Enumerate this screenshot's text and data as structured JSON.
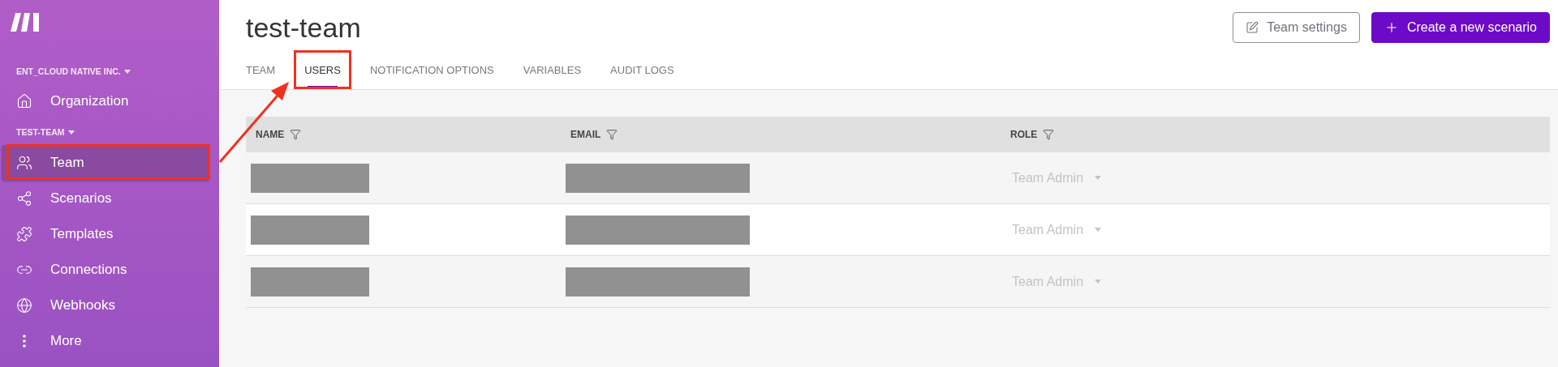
{
  "sidebar": {
    "org_heading": "ENT_CLOUD NATIVE INC.",
    "items_top": [
      {
        "label": "Organization",
        "selected": false,
        "highlighted": false
      }
    ],
    "team_heading": "TEST-TEAM",
    "items": [
      {
        "label": "Team",
        "selected": true,
        "highlighted": true
      },
      {
        "label": "Scenarios",
        "selected": false,
        "highlighted": false
      },
      {
        "label": "Templates",
        "selected": false,
        "highlighted": false
      },
      {
        "label": "Connections",
        "selected": false,
        "highlighted": false
      },
      {
        "label": "Webhooks",
        "selected": false,
        "highlighted": false
      },
      {
        "label": "More",
        "selected": false,
        "highlighted": false
      }
    ]
  },
  "header": {
    "title": "test-team",
    "buttons": [
      {
        "label": "Team settings",
        "kind": "outline"
      },
      {
        "label": "Create a new scenario",
        "kind": "primary"
      }
    ]
  },
  "tabs": [
    {
      "label": "TEAM",
      "selected": false,
      "highlighted": false
    },
    {
      "label": "USERS",
      "selected": true,
      "highlighted": true
    },
    {
      "label": "NOTIFICATION OPTIONS",
      "selected": false,
      "highlighted": false
    },
    {
      "label": "VARIABLES",
      "selected": false,
      "highlighted": false
    },
    {
      "label": "AUDIT LOGS",
      "selected": false,
      "highlighted": false
    }
  ],
  "annotation_arrow": true,
  "table": {
    "columns": [
      "NAME",
      "EMAIL",
      "ROLE"
    ],
    "rows": [
      {
        "name_redacted": true,
        "email_redacted": true,
        "role": "Team Admin",
        "role_disabled": true
      },
      {
        "name_redacted": true,
        "email_redacted": true,
        "role": "Team Admin",
        "role_disabled": true
      },
      {
        "name_redacted": true,
        "email_redacted": true,
        "role": "Team Admin",
        "role_disabled": true
      }
    ]
  }
}
